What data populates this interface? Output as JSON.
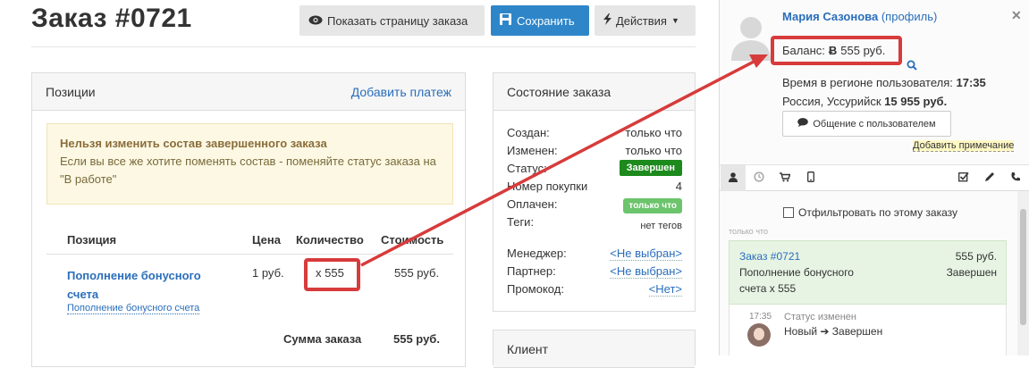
{
  "header": {
    "title": "Заказ #0721",
    "show_page_label": "Показать страницу заказа",
    "save_label": "Сохранить",
    "actions_label": "Действия"
  },
  "positions_panel": {
    "title": "Позиции",
    "add_payment": "Добавить платеж",
    "warning_title": "Нельзя изменить состав завершенного заказа",
    "warning_text": "Если вы все же хотите поменять состав - поменяйте статус заказа на \"В работе\"",
    "columns": [
      "Позиция",
      "Цена",
      "Количество",
      "Стоимость"
    ],
    "rows": [
      {
        "name": "Пополнение бонусного счета",
        "sub": "Пополнение бонусного счета",
        "price": "1 руб.",
        "qty": "x 555",
        "cost": "555 руб."
      }
    ],
    "sum_label": "Сумма заказа",
    "sum_value": "555 руб."
  },
  "state_panel": {
    "title": "Состояние заказа",
    "rows": [
      {
        "label": "Создан:",
        "value": "только что"
      },
      {
        "label": "Изменен:",
        "value": "только что"
      },
      {
        "label": "Статус:",
        "value": "Завершен"
      },
      {
        "label": "Номер покупки",
        "value": "4"
      },
      {
        "label": "Оплачен:",
        "value": "только что"
      },
      {
        "label": "Теги:",
        "value": "нет тегов"
      },
      {
        "label": "Менеджер:",
        "value": "<Не выбран>"
      },
      {
        "label": "Партнер:",
        "value": "<Не выбран>"
      },
      {
        "label": "Промокод:",
        "value": "<Нет>"
      }
    ]
  },
  "client_panel": {
    "title": "Клиент"
  },
  "user": {
    "name": "Мария Сазонова",
    "profile_link": "(профиль)",
    "balance_label": "Баланс:",
    "balance_value": "555 руб.",
    "region_time_label": "Время в регионе пользователя:",
    "region_time": "17:35",
    "location": "Россия, Уссурийск",
    "location_amount": "15 955 руб.",
    "chat_button": "Общение с пользователем",
    "add_note": "Добавить примечание",
    "filter_label": "Отфильтровать по этому заказу"
  },
  "feed": {
    "time_label": "только что",
    "order_card": {
      "title": "Заказ #0721",
      "amount": "555 руб.",
      "line1": "Пополнение бонусного",
      "status": "Завершен",
      "line2": "счета x 555"
    },
    "event": {
      "time": "17:35",
      "title": "Статус изменен",
      "from": "Новый",
      "to": "Завершен"
    }
  },
  "colors": {
    "accent": "#2e86c9",
    "highlight": "#d73b3b",
    "success": "#1c8a1c"
  }
}
